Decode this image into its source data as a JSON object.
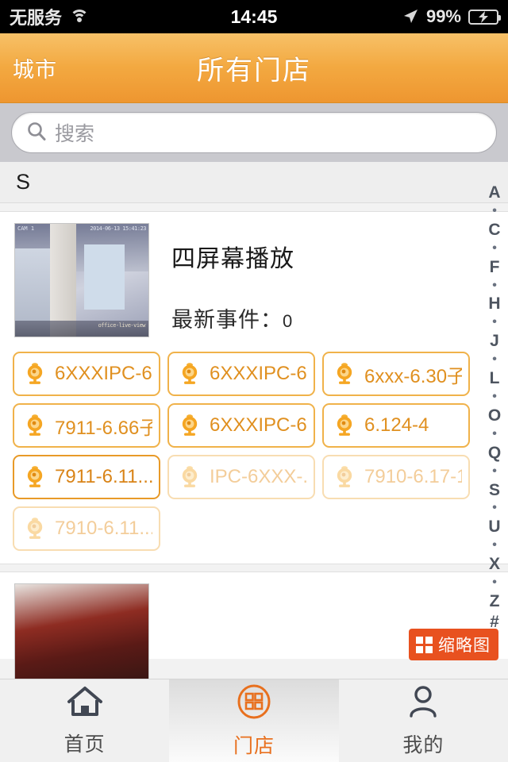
{
  "status_bar": {
    "carrier": "无服务",
    "wifi_icon": "wifi-icon",
    "time": "14:45",
    "location_icon": "location-arrow-icon",
    "battery_percent": "99%",
    "battery_icon": "battery-charging-icon"
  },
  "nav": {
    "back_label": "城市",
    "title": "所有门店",
    "gradient_top": "#f7c168",
    "gradient_bottom": "#ee9630"
  },
  "search": {
    "placeholder": "搜索",
    "value": "",
    "icon": "search-icon"
  },
  "section": {
    "header": "S"
  },
  "store_card": {
    "title": "四屏幕播放",
    "event_label": "最新事件：",
    "event_count": "0",
    "thumbnail_overlay_time": "2014-06-13 15:41:23",
    "thumbnail_corner_label": "CAM 1",
    "thumbnail_bottom_label": "office-live-view",
    "cameras": [
      {
        "label": "6XXXIPC-6...",
        "state": "online"
      },
      {
        "label": "6XXXIPC-6...",
        "state": "online"
      },
      {
        "label": "6xxx-6.30子",
        "state": "online"
      },
      {
        "label": "7911-6.66子",
        "state": "online"
      },
      {
        "label": "6XXXIPC-6...",
        "state": "online"
      },
      {
        "label": "6.124-4",
        "state": "online"
      },
      {
        "label": "7911-6.11...",
        "state": "selected"
      },
      {
        "label": "IPC-6XXX-...",
        "state": "offline"
      },
      {
        "label": "7910-6.17-1",
        "state": "offline"
      },
      {
        "label": "7910-6.11...",
        "state": "offline"
      }
    ]
  },
  "index_bar": {
    "entries": [
      "A",
      "•",
      "C",
      "•",
      "F",
      "•",
      "H",
      "•",
      "J",
      "•",
      "L",
      "•",
      "O",
      "•",
      "Q",
      "•",
      "S",
      "•",
      "U",
      "•",
      "X",
      "•",
      "Z",
      "#"
    ]
  },
  "fab": {
    "label": "缩略图",
    "icon": "grid-icon",
    "background": "#e8511f"
  },
  "tabbar": {
    "items": [
      {
        "label": "首页",
        "icon": "home-icon",
        "active": false
      },
      {
        "label": "门店",
        "icon": "store-grid-icon",
        "active": true
      },
      {
        "label": "我的",
        "icon": "person-icon",
        "active": false
      }
    ],
    "active_color": "#e8701e"
  }
}
